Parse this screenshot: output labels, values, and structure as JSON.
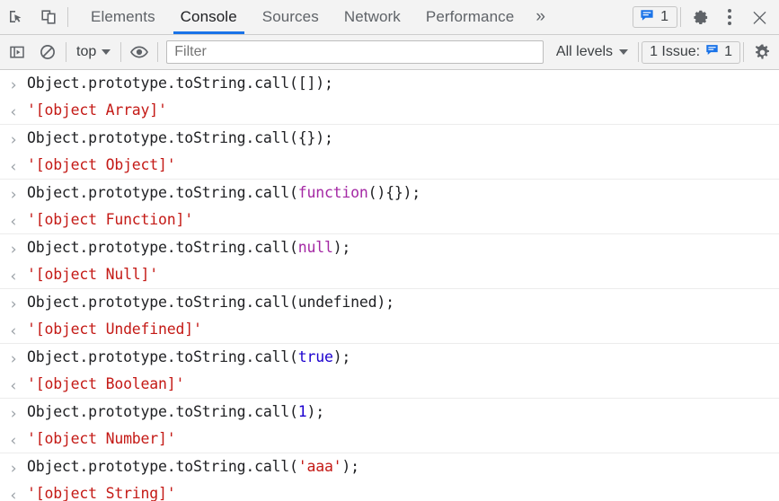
{
  "window": {
    "title": "Chrome DevTools Console"
  },
  "tabbar": {
    "inspect_icon": "inspect-cursor-icon",
    "device_icon": "device-toolbar-icon",
    "tabs": [
      {
        "label": "Elements",
        "active": false
      },
      {
        "label": "Console",
        "active": true
      },
      {
        "label": "Sources",
        "active": false
      },
      {
        "label": "Network",
        "active": false
      },
      {
        "label": "Performance",
        "active": false
      }
    ],
    "more_tabs_label": "»",
    "message_badge": {
      "icon": "message-bubble-icon",
      "count": "1"
    },
    "settings_icon": "gear-icon",
    "menu_icon": "kebab-menu-icon",
    "close_icon": "close-icon"
  },
  "consolebar": {
    "sidebar_toggle_icon": "console-sidebar-icon",
    "clear_icon": "clear-console-icon",
    "context": {
      "label": "top",
      "caret": "chevron-down-icon"
    },
    "eye_icon": "live-expression-eye-icon",
    "filter": {
      "placeholder": "Filter",
      "value": ""
    },
    "levels": {
      "label": "All levels",
      "caret": "chevron-down-icon"
    },
    "issues": {
      "label": "1 Issue:",
      "icon": "message-bubble-icon",
      "count": "1"
    },
    "settings_icon": "gear-icon"
  },
  "colors": {
    "accent": "#1a73e8",
    "toolbar_bg": "#f3f3f3",
    "keyword": "#a428a4",
    "number": "#1c00cf",
    "string": "#c41a16",
    "result": "#c41a16",
    "text": "#202124"
  },
  "console": {
    "input_marker": "›",
    "output_marker": "‹",
    "groups": [
      {
        "input": [
          {
            "t": "Object.prototype.toString.call([]);",
            "c": "plain"
          }
        ],
        "output": "'[object Array]'"
      },
      {
        "input": [
          {
            "t": "Object.prototype.toString.call({});",
            "c": "plain"
          }
        ],
        "output": "'[object Object]'"
      },
      {
        "input": [
          {
            "t": "Object.prototype.toString.call(",
            "c": "plain"
          },
          {
            "t": "function",
            "c": "keyword"
          },
          {
            "t": "(){});",
            "c": "plain"
          }
        ],
        "output": "'[object Function]'"
      },
      {
        "input": [
          {
            "t": "Object.prototype.toString.call(",
            "c": "plain"
          },
          {
            "t": "null",
            "c": "keyword"
          },
          {
            "t": ");",
            "c": "plain"
          }
        ],
        "output": "'[object Null]'"
      },
      {
        "input": [
          {
            "t": "Object.prototype.toString.call(undefined);",
            "c": "plain"
          }
        ],
        "output": "'[object Undefined]'"
      },
      {
        "input": [
          {
            "t": "Object.prototype.toString.call(",
            "c": "plain"
          },
          {
            "t": "true",
            "c": "number"
          },
          {
            "t": ");",
            "c": "plain"
          }
        ],
        "output": "'[object Boolean]'"
      },
      {
        "input": [
          {
            "t": "Object.prototype.toString.call(",
            "c": "plain"
          },
          {
            "t": "1",
            "c": "number"
          },
          {
            "t": ");",
            "c": "plain"
          }
        ],
        "output": "'[object Number]'"
      },
      {
        "input": [
          {
            "t": "Object.prototype.toString.call(",
            "c": "plain"
          },
          {
            "t": "'aaa'",
            "c": "string"
          },
          {
            "t": ");",
            "c": "plain"
          }
        ],
        "output": "'[object String]'"
      }
    ]
  }
}
